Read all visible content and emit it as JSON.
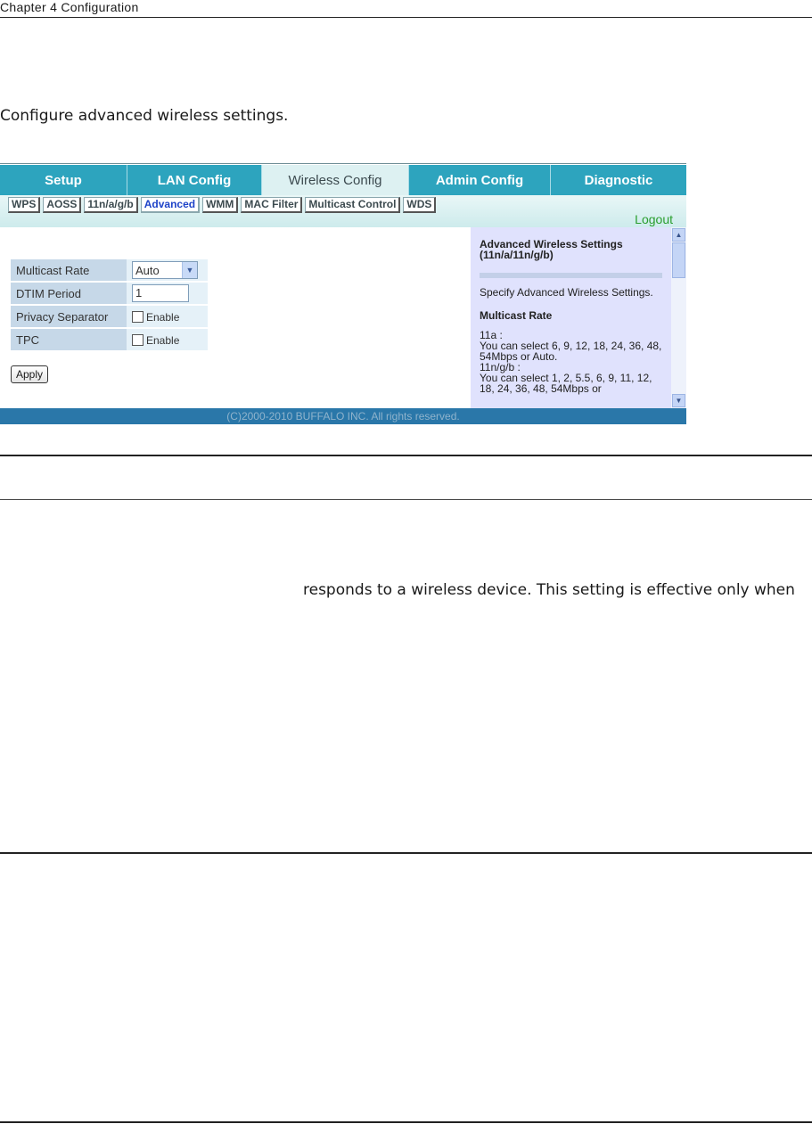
{
  "page": {
    "chapter": "Chapter 4  Configuration",
    "intro": "Configure advanced wireless settings.",
    "body_fragment": "responds to a wireless device. This setting is effective only when"
  },
  "router_ui": {
    "main_tabs": [
      {
        "label": "Setup",
        "active": false
      },
      {
        "label": "LAN Config",
        "active": false
      },
      {
        "label": "Wireless Config",
        "active": true
      },
      {
        "label": "Admin Config",
        "active": false
      },
      {
        "label": "Diagnostic",
        "active": false
      }
    ],
    "sub_tabs": [
      {
        "label": "WPS",
        "active": false
      },
      {
        "label": "AOSS",
        "active": false
      },
      {
        "label": "11n/a/g/b",
        "active": false
      },
      {
        "label": "Advanced",
        "active": true
      },
      {
        "label": "WMM",
        "active": false
      },
      {
        "label": "MAC Filter",
        "active": false
      },
      {
        "label": "Multicast Control",
        "active": false
      },
      {
        "label": "WDS",
        "active": false
      }
    ],
    "logout": "Logout",
    "form": {
      "multicast_rate": {
        "label": "Multicast Rate",
        "value": "Auto"
      },
      "dtim_period": {
        "label": "DTIM Period",
        "value": "1"
      },
      "privacy_separator": {
        "label": "Privacy Separator",
        "checkbox_label": "Enable",
        "checked": false
      },
      "tpc": {
        "label": "TPC",
        "checkbox_label": "Enable",
        "checked": false
      },
      "apply": "Apply"
    },
    "help": {
      "title": "Advanced Wireless Settings (11n/a/11n/g/b)",
      "description": "Specify Advanced Wireless Settings.",
      "section": "Multicast Rate",
      "line_11a": "11a :",
      "text_11a": "You can select 6, 9, 12, 18, 24, 36, 48, 54Mbps or Auto.",
      "line_11ngb": "11n/g/b :",
      "text_11ngb": "You can select 1, 2, 5.5, 6, 9, 11, 12, 18, 24, 36, 48, 54Mbps or"
    },
    "footer": "(C)2000-2010 BUFFALO INC. All rights reserved.",
    "colors": {
      "tab": "#2da4be",
      "active_tab": "#ddf1f2",
      "footer": "#2a77a9",
      "help_bg": "#e0e2fd",
      "logout": "#2a9e2e"
    }
  }
}
